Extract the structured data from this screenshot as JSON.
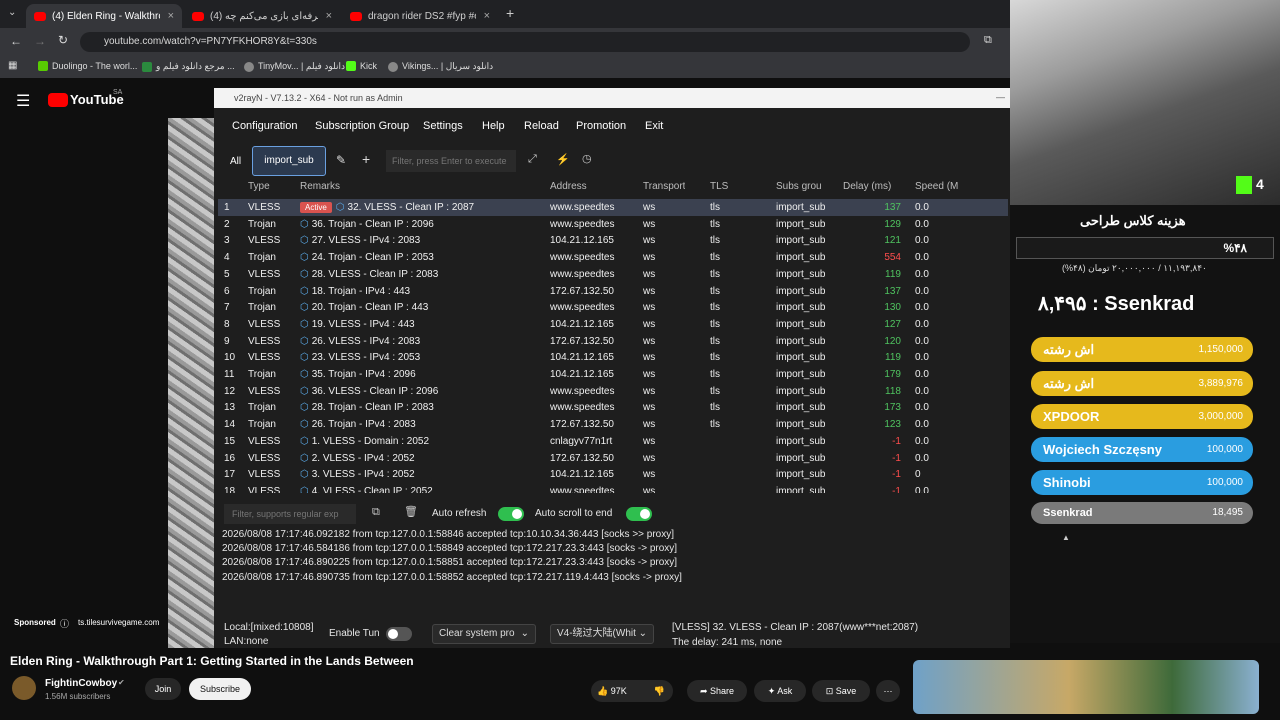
{
  "browser": {
    "tabs": [
      {
        "label": "(4) Elden Ring - Walkthrough P"
      },
      {
        "label": "(4) وقتی حرفه‌ای بازی می‌کنم چه..."
      },
      {
        "label": "dragon rider DS2 #fyp #explore"
      }
    ],
    "new_tab": "+",
    "url": "youtube.com/watch?v=PN7YFKHOR8Y&t=330s",
    "bookmarks": [
      {
        "label": "Duolingo - The worl..."
      },
      {
        "label": "مرجع دانلود فیلم و ..."
      },
      {
        "label": "TinyMov... | دانلود فیلم"
      },
      {
        "label": "Kick"
      },
      {
        "label": "Vikings... | دانلود سریال"
      }
    ]
  },
  "youtube": {
    "logo": "YouTube",
    "country": "SA",
    "sponsored_label": "Sponsored",
    "sponsored_url": "ts.tilesurvivegame.com",
    "video_title": "Elden Ring - Walkthrough Part 1: Getting Started in the Lands Between",
    "channel_name": "FightinCowboy",
    "subscribers": "1.56M subscribers",
    "join": "Join",
    "subscribe": "Subscribe",
    "likes": "97K",
    "share": "Share",
    "ask": "Ask",
    "save": "Save"
  },
  "v2ray": {
    "window_title": "v2rayN - V7.13.2 - X64 - Not run as Admin",
    "menu": [
      "Configuration",
      "Subscription Group",
      "Settings",
      "Help",
      "Reload",
      "Promotion",
      "Exit"
    ],
    "tabs": {
      "all": "All",
      "group": "import_sub"
    },
    "filter_placeholder": "Filter, press Enter to execute",
    "columns": [
      "Type",
      "Remarks",
      "Address",
      "Transport",
      "TLS",
      "Subs grou",
      "Delay (ms)",
      "Speed (M"
    ],
    "active_badge": "Active",
    "rows": [
      {
        "n": "1",
        "type": "VLESS",
        "remarks": "32. VLESS - Clean IP : 2087",
        "address": "www.speedtes",
        "transport": "ws",
        "tls": "tls",
        "sub": "import_sub",
        "delay": "137",
        "speed": "0.0"
      },
      {
        "n": "2",
        "type": "Trojan",
        "remarks": "36. Trojan - Clean IP : 2096",
        "address": "www.speedtes",
        "transport": "ws",
        "tls": "tls",
        "sub": "import_sub",
        "delay": "129",
        "speed": "0.0"
      },
      {
        "n": "3",
        "type": "VLESS",
        "remarks": "27. VLESS - IPv4 : 2083",
        "address": "104.21.12.165",
        "transport": "ws",
        "tls": "tls",
        "sub": "import_sub",
        "delay": "121",
        "speed": "0.0"
      },
      {
        "n": "4",
        "type": "Trojan",
        "remarks": "24. Trojan - Clean IP : 2053",
        "address": "www.speedtes",
        "transport": "ws",
        "tls": "tls",
        "sub": "import_sub",
        "delay": "554",
        "speed": "0.0"
      },
      {
        "n": "5",
        "type": "VLESS",
        "remarks": "28. VLESS - Clean IP : 2083",
        "address": "www.speedtes",
        "transport": "ws",
        "tls": "tls",
        "sub": "import_sub",
        "delay": "119",
        "speed": "0.0"
      },
      {
        "n": "6",
        "type": "Trojan",
        "remarks": "18. Trojan - IPv4 : 443",
        "address": "172.67.132.50",
        "transport": "ws",
        "tls": "tls",
        "sub": "import_sub",
        "delay": "137",
        "speed": "0.0"
      },
      {
        "n": "7",
        "type": "Trojan",
        "remarks": "20. Trojan - Clean IP : 443",
        "address": "www.speedtes",
        "transport": "ws",
        "tls": "tls",
        "sub": "import_sub",
        "delay": "130",
        "speed": "0.0"
      },
      {
        "n": "8",
        "type": "VLESS",
        "remarks": "19. VLESS - IPv4 : 443",
        "address": "104.21.12.165",
        "transport": "ws",
        "tls": "tls",
        "sub": "import_sub",
        "delay": "127",
        "speed": "0.0"
      },
      {
        "n": "9",
        "type": "VLESS",
        "remarks": "26. VLESS - IPv4 : 2083",
        "address": "172.67.132.50",
        "transport": "ws",
        "tls": "tls",
        "sub": "import_sub",
        "delay": "120",
        "speed": "0.0"
      },
      {
        "n": "10",
        "type": "VLESS",
        "remarks": "23. VLESS - IPv4 : 2053",
        "address": "104.21.12.165",
        "transport": "ws",
        "tls": "tls",
        "sub": "import_sub",
        "delay": "119",
        "speed": "0.0"
      },
      {
        "n": "11",
        "type": "Trojan",
        "remarks": "35. Trojan - IPv4 : 2096",
        "address": "104.21.12.165",
        "transport": "ws",
        "tls": "tls",
        "sub": "import_sub",
        "delay": "179",
        "speed": "0.0"
      },
      {
        "n": "12",
        "type": "VLESS",
        "remarks": "36. VLESS - Clean IP : 2096",
        "address": "www.speedtes",
        "transport": "ws",
        "tls": "tls",
        "sub": "import_sub",
        "delay": "118",
        "speed": "0.0"
      },
      {
        "n": "13",
        "type": "Trojan",
        "remarks": "28. Trojan - Clean IP : 2083",
        "address": "www.speedtes",
        "transport": "ws",
        "tls": "tls",
        "sub": "import_sub",
        "delay": "173",
        "speed": "0.0"
      },
      {
        "n": "14",
        "type": "Trojan",
        "remarks": "26. Trojan - IPv4 : 2083",
        "address": "172.67.132.50",
        "transport": "ws",
        "tls": "tls",
        "sub": "import_sub",
        "delay": "123",
        "speed": "0.0"
      },
      {
        "n": "15",
        "type": "VLESS",
        "remarks": "1. VLESS - Domain : 2052",
        "address": "cnlagyv77n1rt",
        "transport": "ws",
        "tls": "",
        "sub": "import_sub",
        "delay": "-1",
        "speed": "0.0"
      },
      {
        "n": "16",
        "type": "VLESS",
        "remarks": "2. VLESS - IPv4 : 2052",
        "address": "172.67.132.50",
        "transport": "ws",
        "tls": "",
        "sub": "import_sub",
        "delay": "-1",
        "speed": "0.0"
      },
      {
        "n": "17",
        "type": "VLESS",
        "remarks": "3. VLESS - IPv4 : 2052",
        "address": "104.21.12.165",
        "transport": "ws",
        "tls": "",
        "sub": "import_sub",
        "delay": "-1",
        "speed": "0"
      },
      {
        "n": "18",
        "type": "VLESS",
        "remarks": "4. VLESS - Clean IP : 2052",
        "address": "www.speedtes",
        "transport": "ws",
        "tls": "",
        "sub": "import_sub",
        "delay": "-1",
        "speed": "0.0"
      }
    ],
    "log_filter_placeholder": "Filter, supports regular exp",
    "auto_refresh": "Auto refresh",
    "auto_scroll": "Auto scroll to end",
    "log_lines": [
      "2026/08/08 17:17:46.092182 from tcp:127.0.0.1:58846 accepted tcp:10.10.34.36:443 [socks >> proxy]",
      "2026/08/08 17:17:46.584186 from tcp:127.0.0.1:58849 accepted tcp:172.217.23.3:443 [socks -> proxy]",
      "2026/08/08 17:17:46.890225 from tcp:127.0.0.1:58851 accepted tcp:172.217.23.3:443 [socks -> proxy]",
      "2026/08/08 17:17:46.890735 from tcp:127.0.0.1:58852 accepted tcp:172.217.119.4:443 [socks -> proxy]"
    ],
    "local": "Local:[mixed:10808]",
    "lan": "LAN:none",
    "enable_tun": "Enable Tun",
    "system_proxy": "Clear system pro",
    "routing": "V4-绕过大陆(Whit",
    "status_server": "[VLESS]  32. VLESS - Clean IP : 2087(www***net:2087)",
    "status_delay": "The delay: 241 ms, none"
  },
  "stream": {
    "kick_count": "4",
    "goal_title": "هزینه کلاس طراحی",
    "goal_percent": "%۴۸",
    "goal_amount": "۱۱,۱۹۳,۸۴۰ / ۲۰,۰۰۰,۰۰۰ تومان (۴۸%)",
    "top_line": "۸,۴۹۵ : Ssenkrad",
    "donors": [
      {
        "name": "اش رشته",
        "amount": "1,150,000",
        "color": "#e6b91c"
      },
      {
        "name": "اش رشته",
        "amount": "3,889,976",
        "color": "#e6b91c"
      },
      {
        "name": "XPDOOR",
        "amount": "3,000,000",
        "color": "#e6b91c"
      },
      {
        "name": "Wojciech Szczęsny",
        "amount": "100,000",
        "color": "#2a9de0"
      },
      {
        "name": "Shinobi",
        "amount": "100,000",
        "color": "#2a9de0"
      },
      {
        "name": "Ssenkrad",
        "amount": "18,495",
        "color": "#7a7a7a"
      }
    ]
  }
}
